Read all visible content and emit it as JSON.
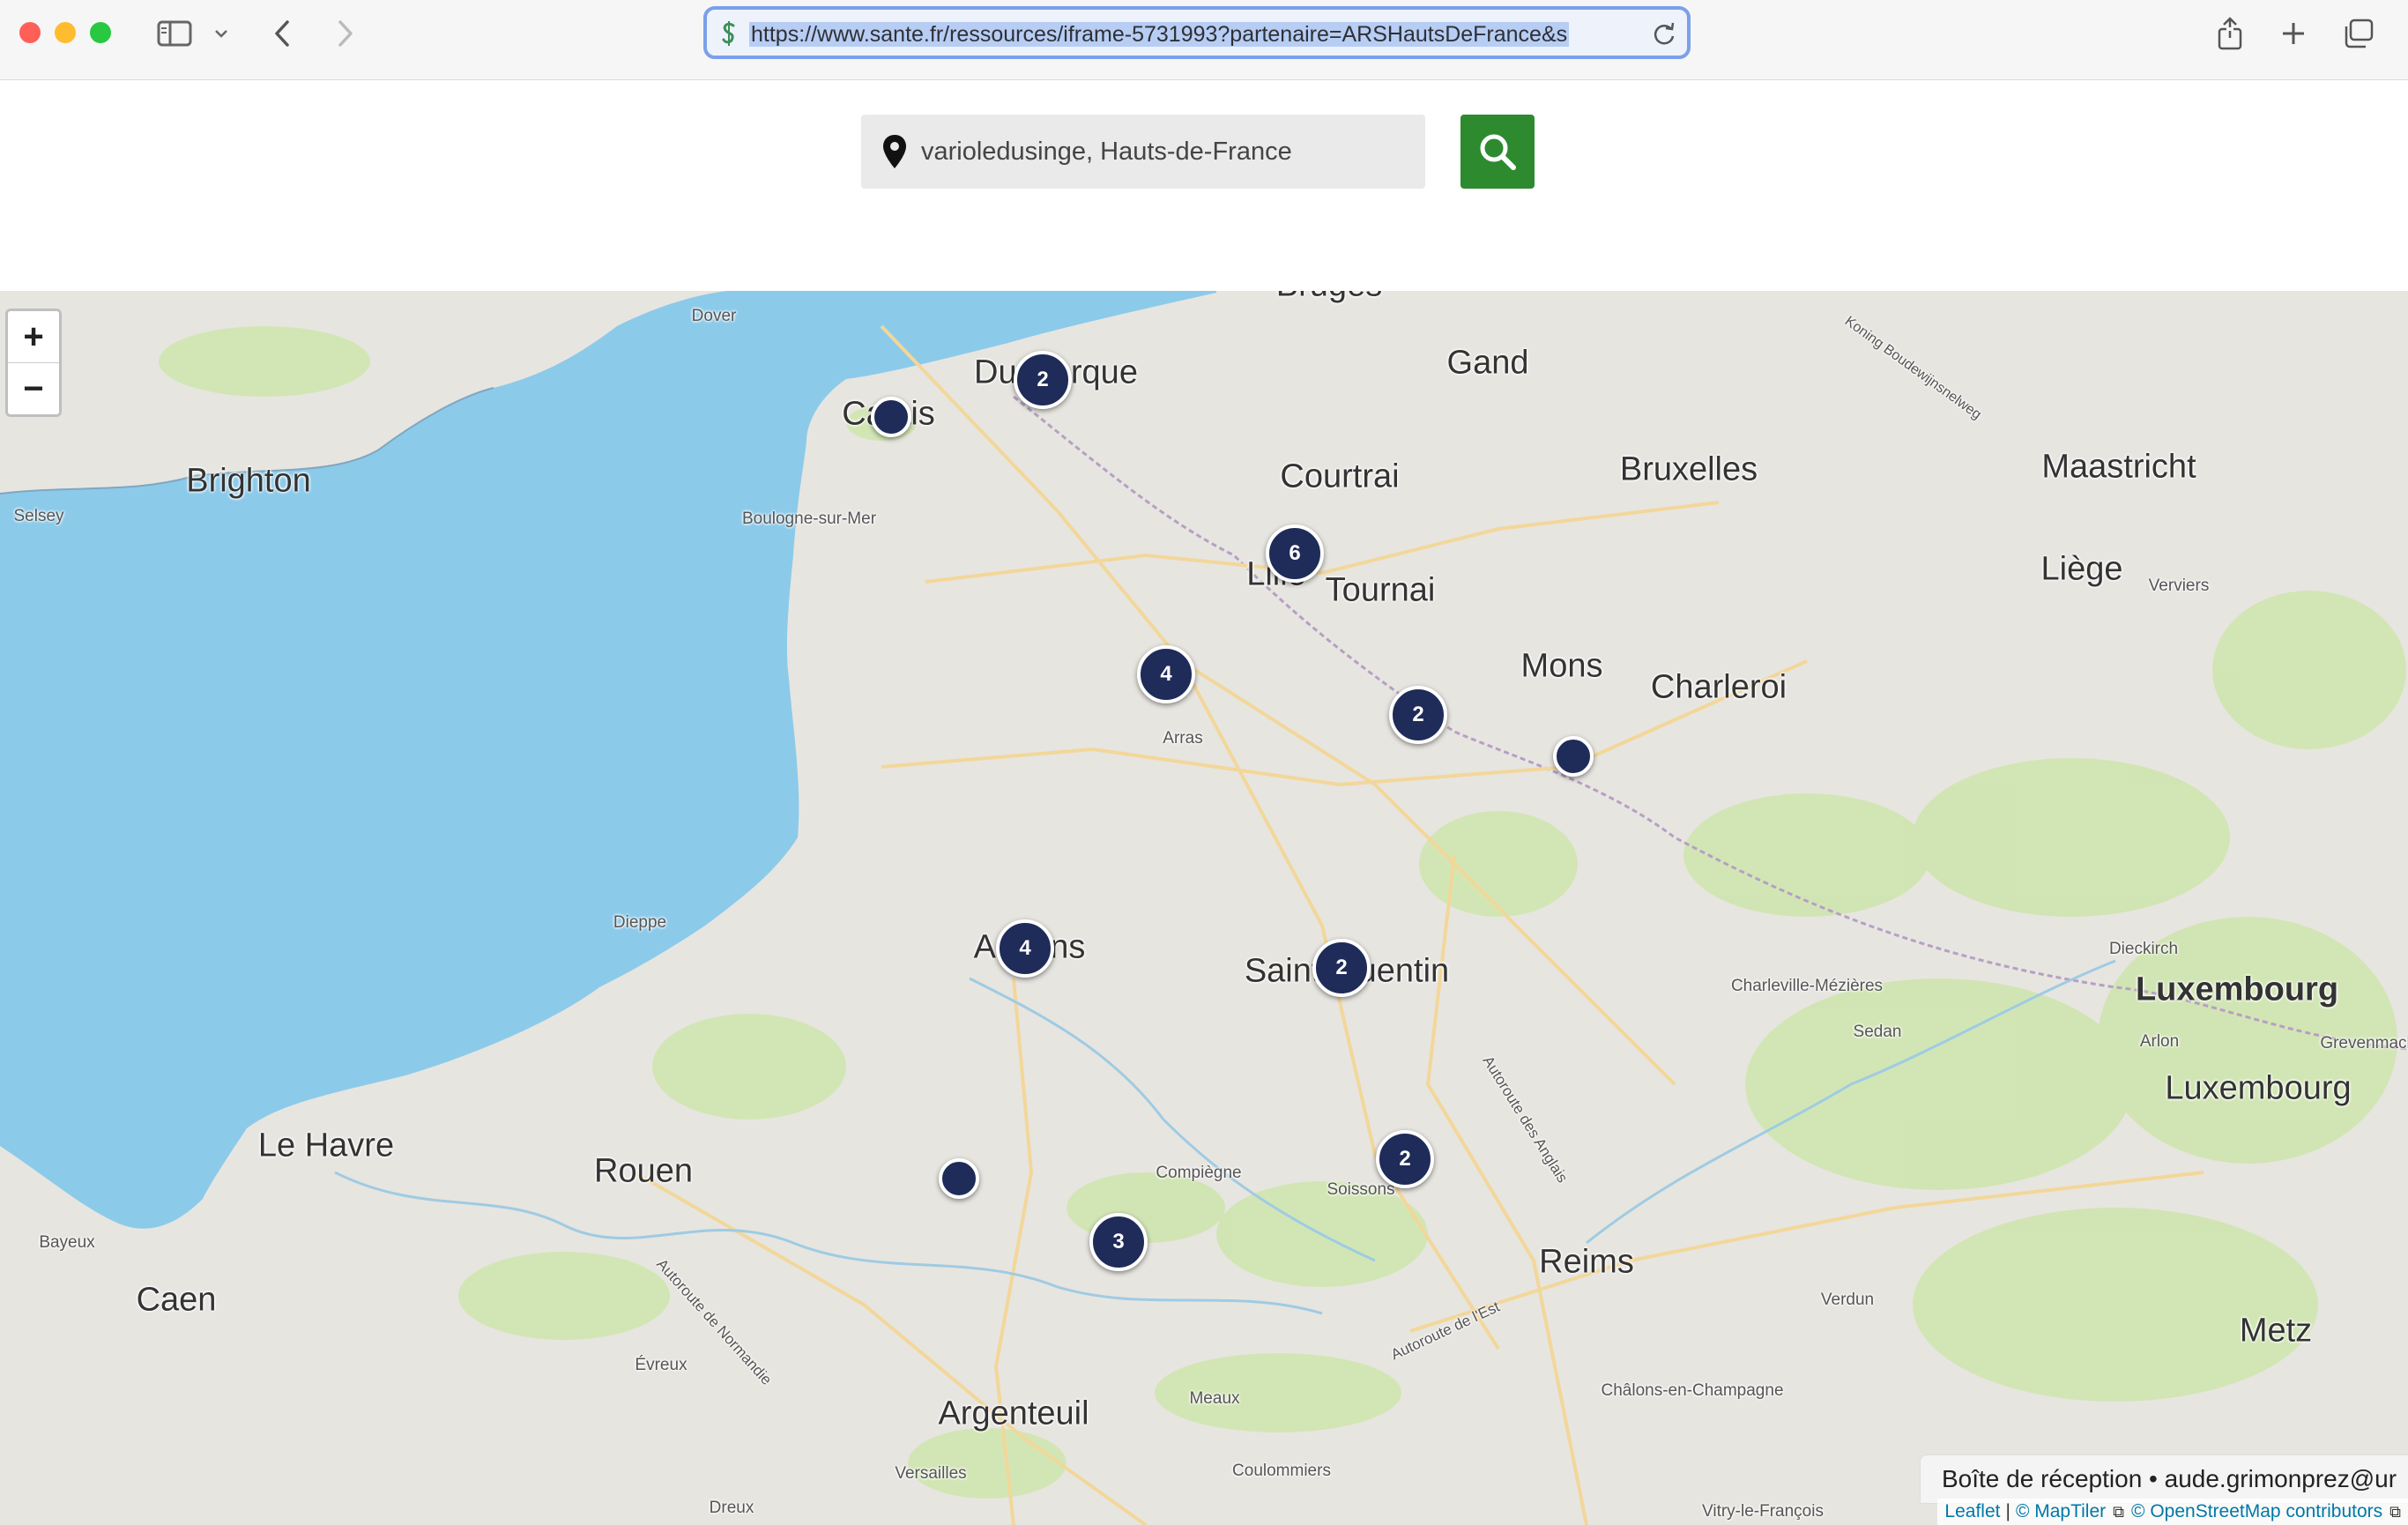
{
  "browser": {
    "url": "https://www.sante.fr/ressources/iframe-5731993?partenaire=ARSHautsDeFrance&s"
  },
  "search": {
    "value": "varioledusinge, Hauts-de-France"
  },
  "map": {
    "zoom_in": "+",
    "zoom_out": "−",
    "labels": [
      {
        "text": "Bruges",
        "size": "big"
      },
      {
        "text": "Dover",
        "size": "small"
      },
      {
        "text": "Dunkerque",
        "size": "big"
      },
      {
        "text": "Gand",
        "size": "big"
      },
      {
        "text": "Calais",
        "size": "big"
      },
      {
        "text": "Brighton",
        "size": "big"
      },
      {
        "text": "Selsey",
        "size": "small"
      },
      {
        "text": "Boulogne-sur-Mer",
        "size": "small"
      },
      {
        "text": "Courtrai",
        "size": "big"
      },
      {
        "text": "Bruxelles",
        "size": "big"
      },
      {
        "text": "Maastricht",
        "size": "big"
      },
      {
        "text": "Lille",
        "size": "big"
      },
      {
        "text": "Tournai",
        "size": "big"
      },
      {
        "text": "Liège",
        "size": "big"
      },
      {
        "text": "Verviers",
        "size": "small"
      },
      {
        "text": "Mons",
        "size": "big"
      },
      {
        "text": "Charleroi",
        "size": "big"
      },
      {
        "text": "Arras",
        "size": "small"
      },
      {
        "text": "Dieppe",
        "size": "small"
      },
      {
        "text": "Amiens",
        "size": "big"
      },
      {
        "text": "Saint-Quentin",
        "size": "big"
      },
      {
        "text": "Dieckirch",
        "size": "small"
      },
      {
        "text": "Charleville-Mézières",
        "size": "small"
      },
      {
        "text": "Luxembourg",
        "size": "big"
      },
      {
        "text": "Sedan",
        "size": "small"
      },
      {
        "text": "Arlon",
        "size": "small"
      },
      {
        "text": "Grevenmache",
        "size": "small"
      },
      {
        "text": "Luxembourg",
        "size": "big"
      },
      {
        "text": "Le Havre",
        "size": "big"
      },
      {
        "text": "Rouen",
        "size": "big"
      },
      {
        "text": "Compiègne",
        "size": "small"
      },
      {
        "text": "Soissons",
        "size": "small"
      },
      {
        "text": "Bayeux",
        "size": "small"
      },
      {
        "text": "Caen",
        "size": "big"
      },
      {
        "text": "Reims",
        "size": "big"
      },
      {
        "text": "Verdun",
        "size": "small"
      },
      {
        "text": "Metz",
        "size": "big"
      },
      {
        "text": "Évreux",
        "size": "small"
      },
      {
        "text": "Argenteuil",
        "size": "big"
      },
      {
        "text": "Meaux",
        "size": "small"
      },
      {
        "text": "Châlons-en-Champagne",
        "size": "small"
      },
      {
        "text": "Versailles",
        "size": "small"
      },
      {
        "text": "Coulommiers",
        "size": "small"
      },
      {
        "text": "Dreux",
        "size": "small"
      },
      {
        "text": "Vitry-le-François",
        "size": "small"
      },
      {
        "text": "Autoroute de Normandie",
        "size": "small"
      },
      {
        "text": "Autoroute des Anglais",
        "size": "small"
      },
      {
        "text": "Autoroute de l'Est",
        "size": "small"
      },
      {
        "text": "Koning Boudewijnsnelweg",
        "size": "small"
      }
    ],
    "markers": [
      {
        "count": "2",
        "type": "cluster"
      },
      {
        "count": "",
        "type": "single"
      },
      {
        "count": "6",
        "type": "cluster"
      },
      {
        "count": "4",
        "type": "cluster"
      },
      {
        "count": "2",
        "type": "cluster"
      },
      {
        "count": "",
        "type": "single"
      },
      {
        "count": "4",
        "type": "cluster"
      },
      {
        "count": "2",
        "type": "cluster"
      },
      {
        "count": "2",
        "type": "cluster"
      },
      {
        "count": "",
        "type": "single"
      },
      {
        "count": "3",
        "type": "cluster"
      }
    ],
    "notification": "Boîte de réception • aude.grimonprez@ur",
    "attribution": {
      "leaflet": "Leaflet",
      "sep": "|",
      "maptiler": "© MapTiler",
      "osm": "© OpenStreetMap contributors"
    }
  },
  "colors": {
    "marker": "#1f2b58",
    "search_button": "#2e8a2e",
    "sea": "#8ccaea",
    "land": "#e7e5e0"
  }
}
